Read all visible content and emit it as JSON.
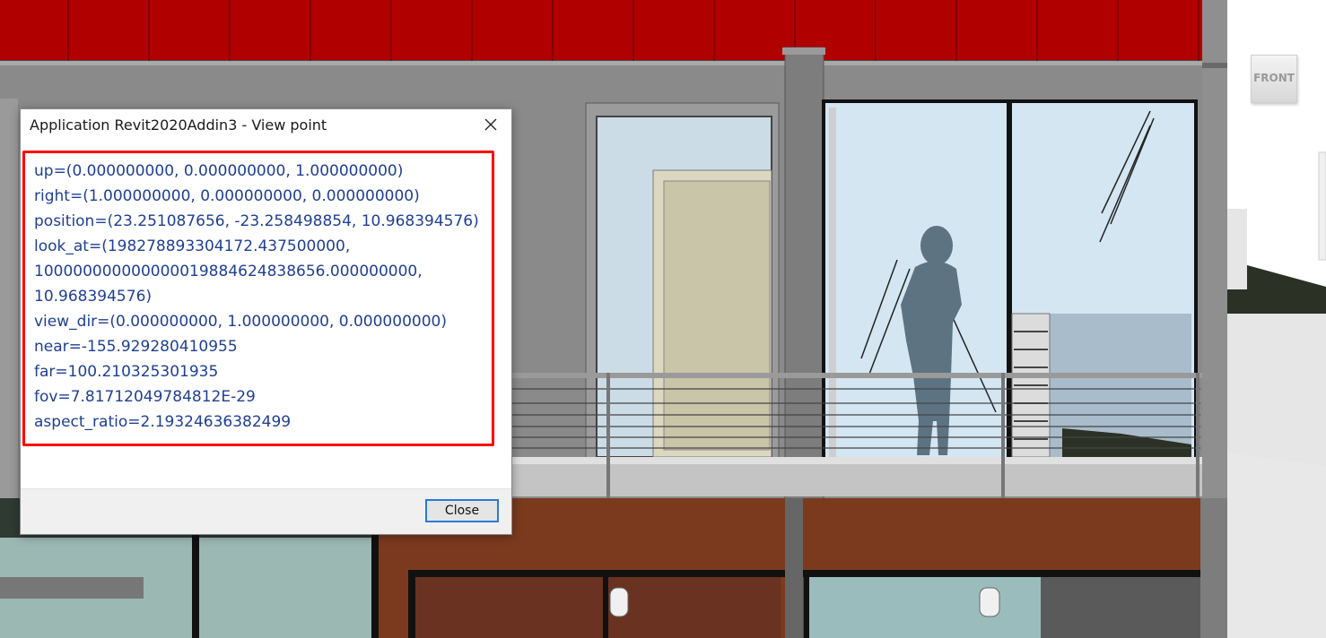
{
  "dialog": {
    "title": "Application Revit2020Addin3 - View point",
    "lines": [
      "up=(0.000000000, 0.000000000, 1.000000000)",
      "right=(1.000000000, 0.000000000, 0.000000000)",
      "position=(23.251087656, -23.258498854, 10.968394576)",
      "look_at=(198278893304172.437500000,",
      "100000000000000019884624838656.000000000,",
      "10.968394576)",
      "view_dir=(0.000000000, 1.000000000, 0.000000000)",
      "near=-155.929280410955",
      "far=100.210325301935",
      "fov=7.81712049784812E-29",
      "aspect_ratio=2.19324636382499"
    ],
    "close_button_label": "Close",
    "close_icon": "close-icon"
  },
  "viewcube": {
    "label": "FRONT"
  },
  "colors": {
    "roof_red": "#b00000",
    "wall_gray": "#8a8a8a",
    "glass_blue": "#cfe3ef",
    "brick_brown": "#7b3a1e",
    "highlight_border": "#ff0000",
    "text_blue": "#1f3f93"
  }
}
